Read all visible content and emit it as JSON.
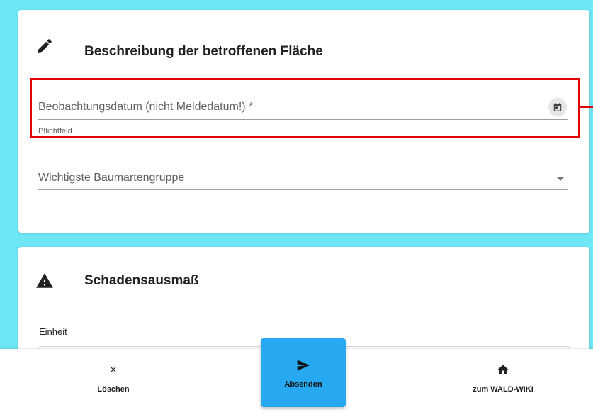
{
  "section_description": {
    "title": "Beschreibung der betroffenen Fläche",
    "icon": "pencil-icon"
  },
  "observation_date": {
    "label": "Beobachtungsdatum (nicht Meldedatum!) *",
    "hint": "Pflichtfeld",
    "icon": "calendar-icon"
  },
  "tree_species_group": {
    "label": "Wichtigste Baumartengruppe",
    "icon": "dropdown-caret-icon"
  },
  "section_damage": {
    "title": "Schadensausmaß",
    "icon": "warning-icon"
  },
  "unit": {
    "label": "Einheit"
  },
  "bottom_nav": {
    "delete_label": "Löschen",
    "submit_label": "Absenden",
    "wiki_label": "zum WALD-WIKI"
  },
  "colors": {
    "background": "#6fe6f5",
    "highlight": "#e00000",
    "submit": "#26a9f0"
  }
}
